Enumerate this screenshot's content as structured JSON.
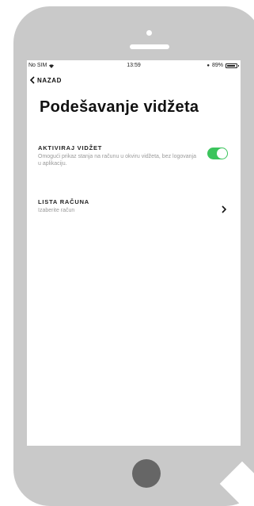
{
  "status_bar": {
    "carrier": "No SIM",
    "time": "13:59",
    "battery": "89%"
  },
  "nav": {
    "back_label": "NAZAD"
  },
  "page": {
    "title": "Podešavanje vidžeta"
  },
  "settings": [
    {
      "title": "AKTIVIRAJ VIDŽET",
      "description": "Omogući prikaz stanja na računu u okviru vidžeta, bez logovanja u aplikaciju.",
      "control": "toggle",
      "enabled": true
    },
    {
      "title": "LISTA RAČUNA",
      "description": "Izaberite račun",
      "control": "chevron-right-icon"
    }
  ],
  "colors": {
    "toggle_on": "#3bc45c",
    "phone_shell": "#c9c9c9",
    "home_button": "#666666"
  }
}
